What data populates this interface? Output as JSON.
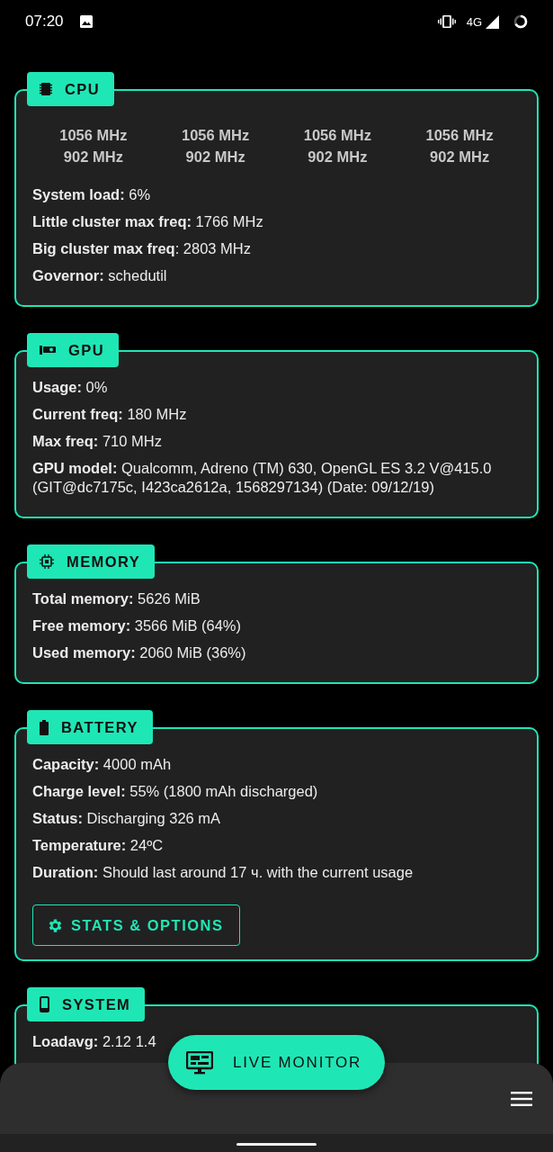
{
  "status_bar": {
    "time": "07:20",
    "network": "4G"
  },
  "sections": [
    {
      "kind": "cpu",
      "title": "CPU",
      "cores": [
        {
          "current": "1056 MHz",
          "min": "902 MHz"
        },
        {
          "current": "1056 MHz",
          "min": "902 MHz"
        },
        {
          "current": "1056 MHz",
          "min": "902 MHz"
        },
        {
          "current": "1056 MHz",
          "min": "902 MHz"
        }
      ],
      "rows": [
        "**System load:** 6%",
        "**Little cluster max freq:** 1766 MHz",
        "**Big cluster max freq**: 2803 MHz",
        "**Governor:** schedutil"
      ]
    },
    {
      "kind": "gpu",
      "title": "GPU",
      "rows": [
        "**Usage:** 0%",
        "**Current freq:** 180 MHz",
        "**Max freq:** 710 MHz",
        "**GPU model:** Qualcomm, Adreno (TM) 630, OpenGL ES 3.2 V@415.0 (GIT@dc7175c, I423ca2612a, 1568297134) (Date: 09/12/19)"
      ]
    },
    {
      "kind": "memory",
      "title": "MEMORY",
      "rows": [
        "**Total memory:** 5626 MiB",
        "**Free memory:** 3566 MiB (64%)",
        "**Used memory:** 2060 MiB (36%)"
      ]
    },
    {
      "kind": "battery",
      "title": "BATTERY",
      "rows": [
        "**Capacity:** 4000 mAh",
        "**Charge level:** 55% (1800 mAh discharged)",
        "**Status:** Discharging 326 mA",
        "**Temperature:** 24ºC",
        "**Duration:** Should last around 17 ч. with the current usage"
      ],
      "button": "STATS & OPTIONS"
    },
    {
      "kind": "system",
      "title": "SYSTEM",
      "rows": [
        "**Loadavg:** 2.12 1.4"
      ]
    }
  ],
  "fab": {
    "label": "LIVE MONITOR"
  }
}
